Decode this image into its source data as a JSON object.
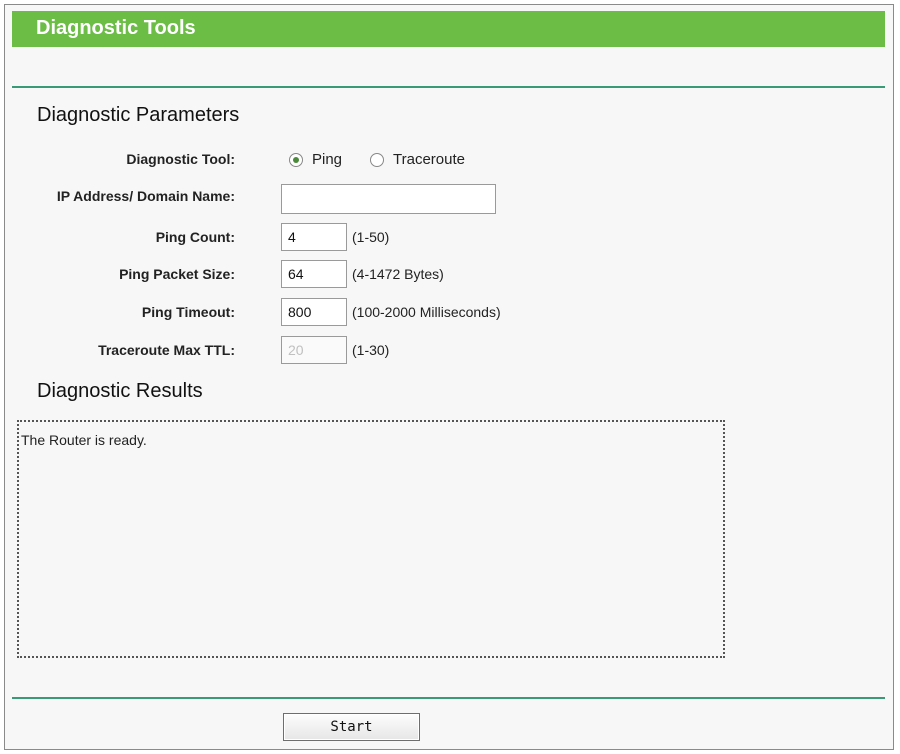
{
  "header": {
    "title": "Diagnostic Tools"
  },
  "parameters": {
    "heading": "Diagnostic Parameters",
    "tool": {
      "label": "Diagnostic Tool:",
      "options": [
        "Ping",
        "Traceroute"
      ],
      "selected": "Ping"
    },
    "ip_address": {
      "label": "IP Address/ Domain Name:",
      "value": ""
    },
    "ping_count": {
      "label": "Ping Count:",
      "value": "4",
      "hint": "(1-50)"
    },
    "ping_packet_size": {
      "label": "Ping Packet Size:",
      "value": "64",
      "hint": "(4-1472 Bytes)"
    },
    "ping_timeout": {
      "label": "Ping Timeout:",
      "value": "800",
      "hint": "(100-2000 Milliseconds)"
    },
    "traceroute_max_ttl": {
      "label": "Traceroute Max TTL:",
      "value": "20",
      "hint": "(1-30)",
      "disabled": true
    }
  },
  "results": {
    "heading": "Diagnostic Results",
    "text": "The Router is ready."
  },
  "actions": {
    "start_label": "Start"
  },
  "colors": {
    "title_bar": "#6cbd45",
    "divider": "#3a9a78"
  }
}
